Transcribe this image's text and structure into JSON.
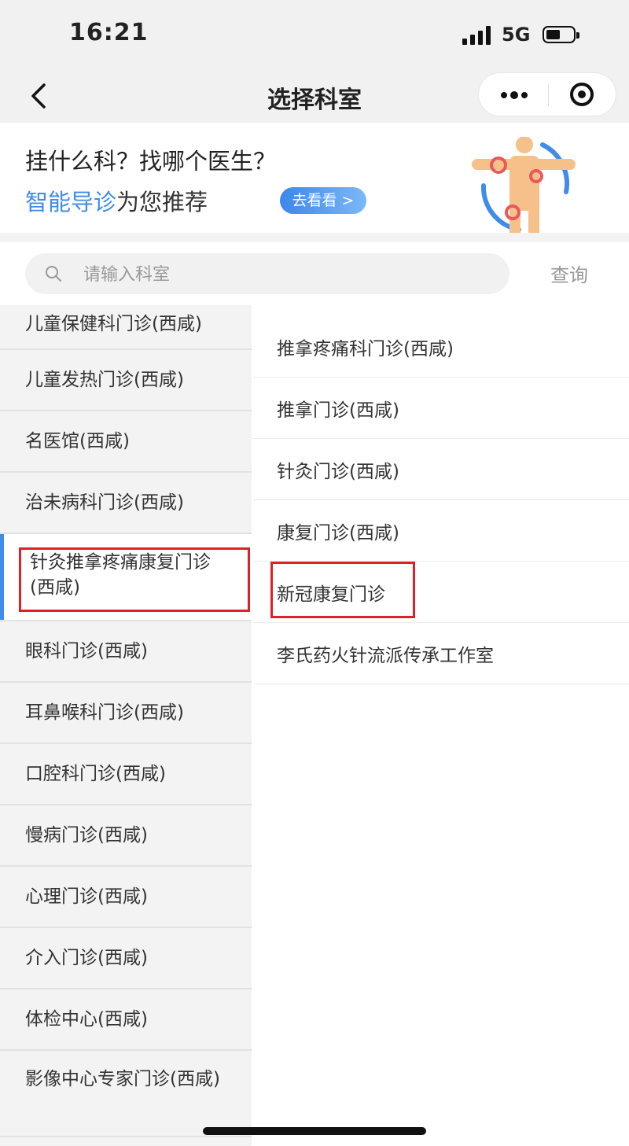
{
  "status_bar": {
    "time": "16:21",
    "network": "5G"
  },
  "nav": {
    "title": "选择科室"
  },
  "banner": {
    "question": "挂什么科？找哪个医生？",
    "sub_highlight": "智能导诊",
    "sub_rest": "为您推荐",
    "button": "去看看 >"
  },
  "search": {
    "placeholder": "请输入科室",
    "button": "查询"
  },
  "left_list": [
    "儿童保健科门诊(西咸)",
    "儿童发热门诊(西咸)",
    "名医馆(西咸)",
    "治未病科门诊(西咸)",
    "针灸推拿疼痛康复门诊(西咸)",
    "眼科门诊(西咸)",
    "耳鼻喉科门诊(西咸)",
    "口腔科门诊(西咸)",
    "慢病门诊(西咸)",
    "心理门诊(西咸)",
    "介入门诊(西咸)",
    "体检中心(西咸)",
    "影像中心专家门诊(西咸)"
  ],
  "left_active_index": 4,
  "right_list": [
    "推拿疼痛科门诊(西咸)",
    "推拿门诊(西咸)",
    "针灸门诊(西咸)",
    "康复门诊(西咸)",
    "新冠康复门诊",
    "李氏药火针流派传承工作室"
  ],
  "colors": {
    "accent": "#3f8ce9",
    "highlight_box": "#e01f26"
  }
}
